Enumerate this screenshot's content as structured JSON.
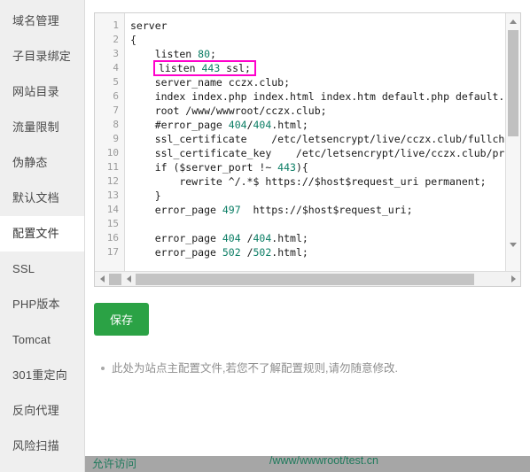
{
  "sidebar": {
    "items": [
      {
        "label": "域名管理",
        "active": false
      },
      {
        "label": "子目录绑定",
        "active": false
      },
      {
        "label": "网站目录",
        "active": false
      },
      {
        "label": "流量限制",
        "active": false
      },
      {
        "label": "伪静态",
        "active": false
      },
      {
        "label": "默认文档",
        "active": false
      },
      {
        "label": "配置文件",
        "active": true
      },
      {
        "label": "SSL",
        "active": false
      },
      {
        "label": "PHP版本",
        "active": false
      },
      {
        "label": "Tomcat",
        "active": false
      },
      {
        "label": "301重定向",
        "active": false
      },
      {
        "label": "反向代理",
        "active": false
      },
      {
        "label": "风险扫描",
        "active": false
      }
    ]
  },
  "editor": {
    "line_numbers": [
      "1",
      "2",
      "3",
      "4",
      "5",
      "6",
      "7",
      "8",
      "9",
      "10",
      "11",
      "12",
      "13",
      "14",
      "15",
      "16",
      "17"
    ],
    "lines": [
      {
        "n": "1",
        "text": "server"
      },
      {
        "n": "2",
        "text": "{"
      },
      {
        "n": "3",
        "text": "    listen 80;"
      },
      {
        "n": "4",
        "text": "listen 443 ssl;",
        "highlighted": true
      },
      {
        "n": "5",
        "text": "    server_name cczx.club;"
      },
      {
        "n": "6",
        "text": "    index index.php index.html index.htm default.php default.htm defau"
      },
      {
        "n": "7",
        "text": "    root /www/wwwroot/cczx.club;"
      },
      {
        "n": "8",
        "text": "    #error_page 404/404.html;"
      },
      {
        "n": "9",
        "text": "    ssl_certificate    /etc/letsencrypt/live/cczx.club/fullchain.pem;"
      },
      {
        "n": "10",
        "text": "    ssl_certificate_key    /etc/letsencrypt/live/cczx.club/privkey.pem"
      },
      {
        "n": "11",
        "text": "    if ($server_port !~ 443){"
      },
      {
        "n": "12",
        "text": "        rewrite ^/.*$ https://$host$request_uri permanent;"
      },
      {
        "n": "13",
        "text": "    }"
      },
      {
        "n": "14",
        "text": "    error_page 497  https://$host$request_uri;"
      },
      {
        "n": "15",
        "text": ""
      },
      {
        "n": "16",
        "text": "    error_page 404 /404.html;"
      },
      {
        "n": "17",
        "text": "    error_page 502 /502.html;"
      }
    ],
    "highlight_color": "#ff00cc",
    "number_token_color": "#0a7d64"
  },
  "actions": {
    "save_label": "保存"
  },
  "notes": [
    "此处为站点主配置文件,若您不了解配置规则,请勿随意修改."
  ],
  "bottom_strip": {
    "col1": "允许访问",
    "col2": "/www/wwwroot/test.cn"
  },
  "scrollbars": {
    "up_arrow": "triangle-up",
    "down_arrow": "triangle-down",
    "left_arrow": "triangle-left",
    "right_arrow": "triangle-right"
  }
}
